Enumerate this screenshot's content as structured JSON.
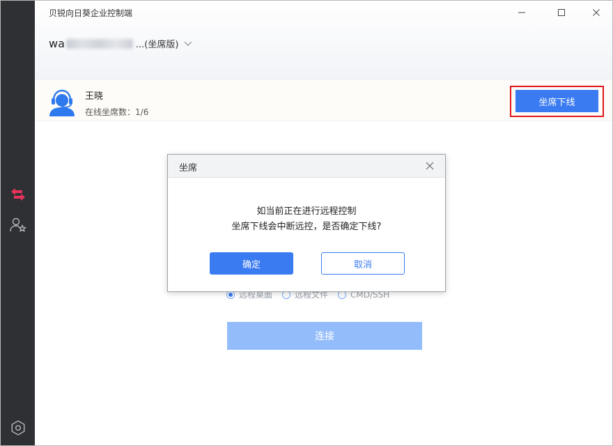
{
  "app": {
    "title": "贝锐向日葵企业控制端"
  },
  "account": {
    "prefix": "wa",
    "suffix": "...(坐席版)"
  },
  "user": {
    "name": "王晓",
    "seat_label": "在线坐席数",
    "seat_count": "1/6",
    "offline_button": "坐席下线"
  },
  "connect_options": [
    {
      "label": "远程桌面",
      "selected": true
    },
    {
      "label": "远程文件",
      "selected": false
    },
    {
      "label": "CMD/SSH",
      "selected": false
    }
  ],
  "connect_button": "连接",
  "dialog": {
    "title": "坐席",
    "line1": "如当前正在进行远程控制",
    "line2": "坐席下线会中断远控，是否确定下线?",
    "ok": "确定",
    "cancel": "取消"
  },
  "colors": {
    "accent": "#3a7bf2",
    "sidebar": "#2f3033",
    "sidebar_active": "#e8345a",
    "highlight": "#e0161b"
  }
}
